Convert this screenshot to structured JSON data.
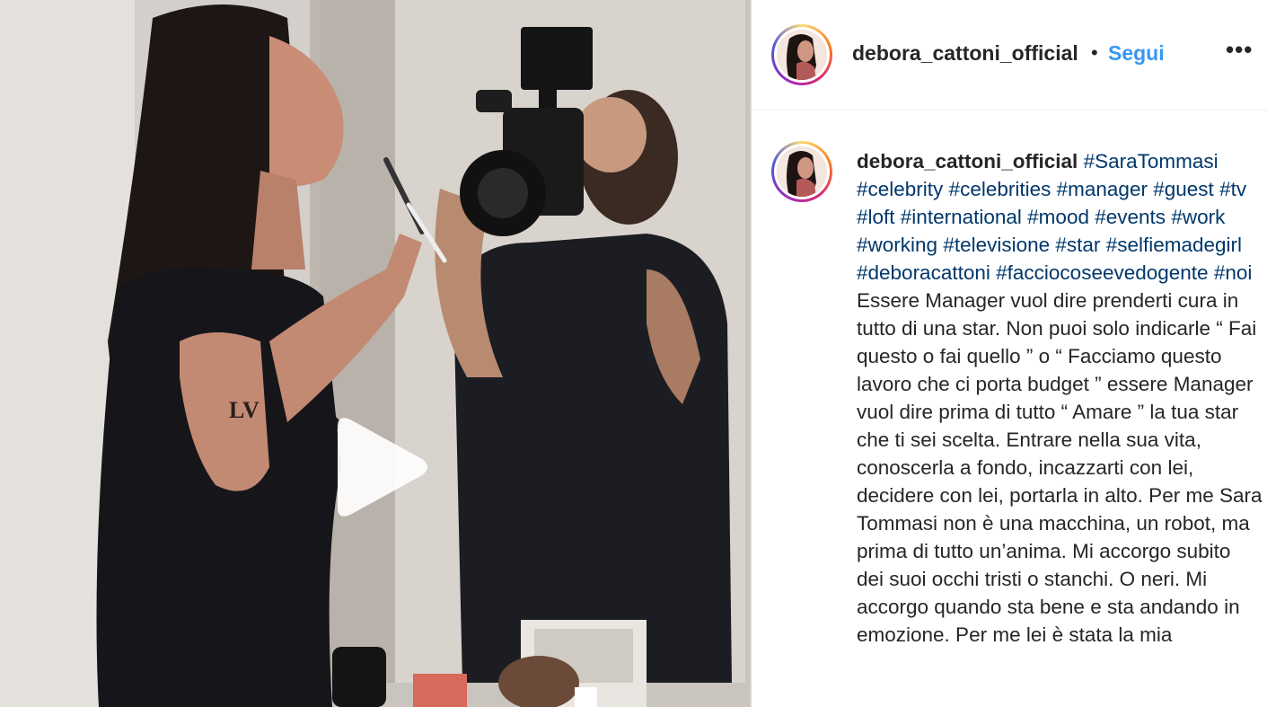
{
  "post": {
    "username": "debora_cattoni_official",
    "separator": "•",
    "follow_label": "Segui",
    "more_label": "•••"
  },
  "caption": {
    "username": "debora_cattoni_official",
    "hashtags": [
      "#SaraTommasi",
      "#celebrity",
      "#celebrities",
      "#manager",
      "#guest",
      "#tv",
      "#loft",
      "#international",
      "#mood",
      "#events",
      "#work",
      "#working",
      "#televisione",
      "#star",
      "#selfiemadegirl",
      "#deboracattoni",
      "#facciocoseevedogente",
      "#noi"
    ],
    "text": "Essere Manager vuol dire prenderti cura in tutto di una star. Non puoi solo indicarle “ Fai questo o fai quello ” o “ Facciamo questo lavoro che ci porta budget ” essere Manager vuol dire prima di tutto “ Amare ” la tua star che ti sei scelta. Entrare nella sua vita, conoscerla a fondo, incazzarti con lei, decidere con lei, portarla in alto. Per me Sara Tommasi non è una macchina, un robot, ma prima di tutto un’anima. Mi accorgo subito dei suoi occhi tristi o stanchi. O neri. Mi accorgo quando sta bene e sta andando in emozione. Per me lei è stata la mia"
  },
  "media": {
    "type": "video",
    "play_icon": "play-icon"
  },
  "colors": {
    "link": "#00376b",
    "follow": "#3897f0",
    "text": "#262626"
  }
}
